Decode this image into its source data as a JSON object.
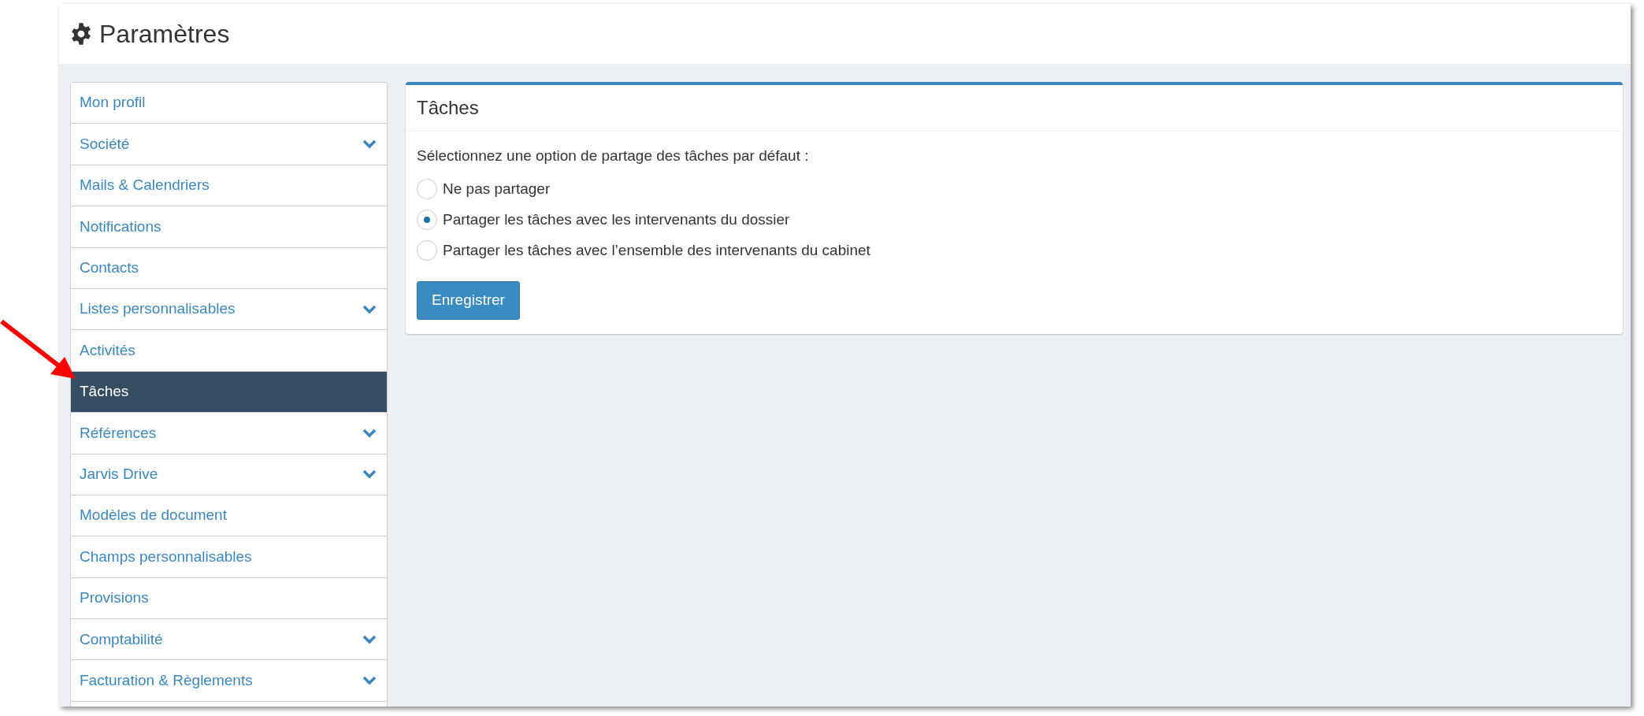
{
  "header": {
    "title": "Paramètres"
  },
  "sidebar": {
    "items": [
      {
        "label": "Mon profil",
        "selected": false,
        "expandable": false
      },
      {
        "label": "Société",
        "selected": false,
        "expandable": true
      },
      {
        "label": "Mails & Calendriers",
        "selected": false,
        "expandable": false
      },
      {
        "label": "Notifications",
        "selected": false,
        "expandable": false
      },
      {
        "label": "Contacts",
        "selected": false,
        "expandable": false
      },
      {
        "label": "Listes personnalisables",
        "selected": false,
        "expandable": true
      },
      {
        "label": "Activités",
        "selected": false,
        "expandable": false
      },
      {
        "label": "Tâches",
        "selected": true,
        "expandable": false
      },
      {
        "label": "Références",
        "selected": false,
        "expandable": true
      },
      {
        "label": "Jarvis Drive",
        "selected": false,
        "expandable": true
      },
      {
        "label": "Modèles de document",
        "selected": false,
        "expandable": false
      },
      {
        "label": "Champs personnalisables",
        "selected": false,
        "expandable": false
      },
      {
        "label": "Provisions",
        "selected": false,
        "expandable": false
      },
      {
        "label": "Comptabilité",
        "selected": false,
        "expandable": true
      },
      {
        "label": "Facturation & Règlements",
        "selected": false,
        "expandable": true
      }
    ]
  },
  "panel": {
    "title": "Tâches",
    "prompt": "Sélectionnez une option de partage des tâches par défaut :",
    "options": [
      {
        "label": "Ne pas partager",
        "selected": false
      },
      {
        "label": "Partager les tâches avec les intervenants du dossier",
        "selected": true
      },
      {
        "label": "Partager les tâches avec l’ensemble des intervenants du cabinet",
        "selected": false
      }
    ],
    "button": "Enregistrer"
  }
}
